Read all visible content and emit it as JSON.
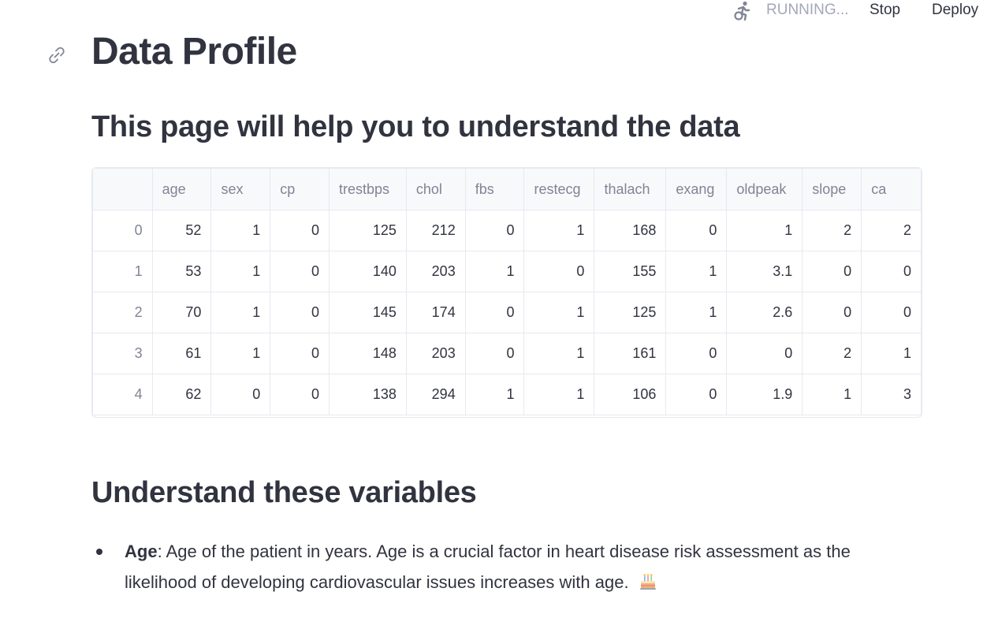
{
  "topbar": {
    "status_label": "RUNNING...",
    "stop_label": "Stop",
    "deploy_label": "Deploy",
    "status_icon": "running-person-icon"
  },
  "page": {
    "title": "Data Profile",
    "subtitle": "This page will help you to understand the data",
    "link_icon": "link-icon"
  },
  "table": {
    "columns": [
      "",
      "age",
      "sex",
      "cp",
      "trestbps",
      "chol",
      "fbs",
      "restecg",
      "thalach",
      "exang",
      "oldpeak",
      "slope",
      "ca"
    ],
    "rows": [
      [
        "0",
        "52",
        "1",
        "0",
        "125",
        "212",
        "0",
        "1",
        "168",
        "0",
        "1",
        "2",
        "2"
      ],
      [
        "1",
        "53",
        "1",
        "0",
        "140",
        "203",
        "1",
        "0",
        "155",
        "1",
        "3.1",
        "0",
        "0"
      ],
      [
        "2",
        "70",
        "1",
        "0",
        "145",
        "174",
        "0",
        "1",
        "125",
        "1",
        "2.6",
        "0",
        "0"
      ],
      [
        "3",
        "61",
        "1",
        "0",
        "148",
        "203",
        "0",
        "1",
        "161",
        "0",
        "0",
        "2",
        "1"
      ],
      [
        "4",
        "62",
        "0",
        "0",
        "138",
        "294",
        "1",
        "1",
        "106",
        "0",
        "1.9",
        "1",
        "3"
      ]
    ]
  },
  "variables": {
    "heading": "Understand these variables",
    "items": [
      {
        "term": "Age",
        "description": ": Age of the patient in years. Age is a crucial factor in heart disease risk assessment as the likelihood of developing cardiovascular issues increases with age.",
        "emoji_icon": "birthday-cake-icon"
      }
    ]
  }
}
